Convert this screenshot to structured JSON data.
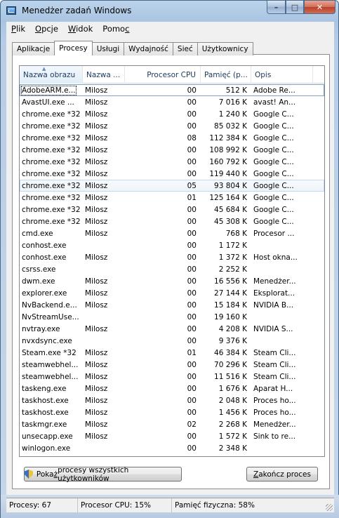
{
  "window": {
    "title": "Menedżer zadań Windows"
  },
  "menu": [
    {
      "pre": "",
      "u": "P",
      "post": "lik"
    },
    {
      "pre": "",
      "u": "O",
      "post": "pcje"
    },
    {
      "pre": "",
      "u": "W",
      "post": "idok"
    },
    {
      "pre": "Pomo",
      "u": "c",
      "post": ""
    }
  ],
  "tabs": [
    "Aplikacje",
    "Procesy",
    "Usługi",
    "Wydajność",
    "Sieć",
    "Użytkownicy"
  ],
  "active_tab": "Procesy",
  "columns": [
    "Nazwa obrazu",
    "Nazwa ...",
    "Procesor CPU",
    "Pamięć (p...",
    "Opis"
  ],
  "rows": [
    [
      "AdobeARM.e...",
      "Milosz",
      "00",
      "512 K",
      "Adobe Re..."
    ],
    [
      "AvastUI.exe ...",
      "Milosz",
      "00",
      "7 016 K",
      "avast! An..."
    ],
    [
      "chrome.exe *32",
      "Milosz",
      "00",
      "1 240 K",
      "Google C..."
    ],
    [
      "chrome.exe *32",
      "Milosz",
      "00",
      "85 032 K",
      "Google C..."
    ],
    [
      "chrome.exe *32",
      "Milosz",
      "08",
      "112 384 K",
      "Google C..."
    ],
    [
      "chrome.exe *32",
      "Milosz",
      "00",
      "108 992 K",
      "Google C..."
    ],
    [
      "chrome.exe *32",
      "Milosz",
      "00",
      "160 792 K",
      "Google C..."
    ],
    [
      "chrome.exe *32",
      "Milosz",
      "00",
      "119 440 K",
      "Google C..."
    ],
    [
      "chrome.exe *32",
      "Milosz",
      "05",
      "93 804 K",
      "Google C..."
    ],
    [
      "chrome.exe *32",
      "Milosz",
      "01",
      "125 164 K",
      "Google C..."
    ],
    [
      "chrome.exe *32",
      "Milosz",
      "00",
      "45 684 K",
      "Google C..."
    ],
    [
      "chrome.exe *32",
      "Milosz",
      "00",
      "45 308 K",
      "Google C..."
    ],
    [
      "cmd.exe",
      "Milosz",
      "00",
      "768 K",
      "Procesor ..."
    ],
    [
      "conhost.exe",
      "",
      "00",
      "1 172 K",
      ""
    ],
    [
      "conhost.exe",
      "Milosz",
      "00",
      "1 372 K",
      "Host okna..."
    ],
    [
      "csrss.exe",
      "",
      "00",
      "2 252 K",
      ""
    ],
    [
      "dwm.exe",
      "Milosz",
      "00",
      "16 556 K",
      "Menedżer..."
    ],
    [
      "explorer.exe",
      "Milosz",
      "00",
      "27 144 K",
      "Eksplorat..."
    ],
    [
      "NvBackend.e...",
      "Milosz",
      "00",
      "15 184 K",
      "NVIDIA B..."
    ],
    [
      "NvStreamUse...",
      "",
      "00",
      "19 160 K",
      ""
    ],
    [
      "nvtray.exe",
      "Milosz",
      "00",
      "4 208 K",
      "NVIDIA S..."
    ],
    [
      "nvxdsync.exe",
      "",
      "00",
      "9 376 K",
      ""
    ],
    [
      "Steam.exe *32",
      "Milosz",
      "01",
      "46 384 K",
      "Steam Cli..."
    ],
    [
      "steamwebhel...",
      "Milosz",
      "00",
      "70 296 K",
      "Steam Cli..."
    ],
    [
      "steamwebhel...",
      "Milosz",
      "00",
      "11 516 K",
      "Steam Cli..."
    ],
    [
      "taskeng.exe",
      "Milosz",
      "00",
      "1 676 K",
      "Aparat H..."
    ],
    [
      "taskhost.exe",
      "Milosz",
      "00",
      "2 048 K",
      "Proces ho..."
    ],
    [
      "taskhost.exe",
      "Milosz",
      "00",
      "1 456 K",
      "Proces ho..."
    ],
    [
      "taskmgr.exe",
      "Milosz",
      "02",
      "2 268 K",
      "Menedżer..."
    ],
    [
      "unsecapp.exe",
      "Milosz",
      "00",
      "1 572 K",
      "Sink to re..."
    ],
    [
      "winlogon.exe",
      "",
      "00",
      "2 348 K",
      ""
    ]
  ],
  "buttons": {
    "show_all": {
      "pre": "Poka",
      "u": "ż",
      "post": " procesy wszystkich użytkowników"
    },
    "end_process": {
      "pre": "",
      "u": "Z",
      "post": "akończ proces"
    }
  },
  "status": {
    "processes": "Procesy: 67",
    "cpu": "Procesor CPU: 15%",
    "memory": "Pamięć fizyczna: 58%"
  }
}
